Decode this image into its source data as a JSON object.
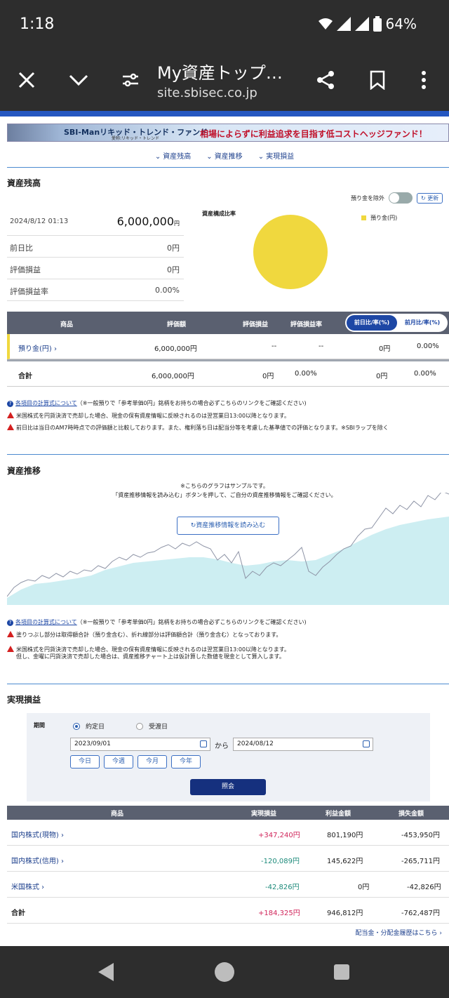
{
  "status": {
    "time": "1:18",
    "battery": "64%"
  },
  "browser": {
    "title": "My資産トップ…",
    "url": "site.sbisec.co.jp"
  },
  "banner": {
    "fund_name": "SBI-Manリキッド・トレンド・ファンド",
    "fund_nickname": "愛称:リキッド・トレンド",
    "tagline": "相場によらずに利益追求を目指す低コストヘッジファンド！"
  },
  "anchors": [
    "資産残高",
    "資産推移",
    "実現損益"
  ],
  "balance": {
    "title": "資産残高",
    "exclude_deposit_label": "預り金を除外",
    "update_label": "更新",
    "datetime": "2024/8/12 01:13",
    "total": "6,000,000",
    "total_unit": "円",
    "rows": [
      {
        "label": "前日比",
        "value": "0円"
      },
      {
        "label": "評価損益",
        "value": "0円"
      },
      {
        "label": "評価損益率",
        "value": "0.00%"
      }
    ],
    "pie_title": "資産構成比率",
    "pie_color": "#f0d83e",
    "legend_label": "預り金(円)",
    "table": {
      "headers": [
        "商品",
        "評価額",
        "評価損益",
        "評価損益率"
      ],
      "toggle_on": "前日比/率(%)",
      "toggle_off": "前月比/率(%)",
      "rows": [
        {
          "name": "預り金(円) ›",
          "value": "6,000,000円",
          "pl": "--",
          "pl_rate": "--",
          "day": "0円",
          "day_rate": "0.00%"
        }
      ],
      "total": {
        "name": "合計",
        "value": "6,000,000円",
        "pl": "0円",
        "pl_rate": "0.00%",
        "day": "0円",
        "day_rate": "0.00%"
      }
    },
    "notes": {
      "calc_link": "各項目の計算式について",
      "calc_rest": "（※一般預りで「参考単価0円」銘柄をお持ちの場合必ずこちらのリンクをご確認ください)",
      "warn1": "米国株式を円貨決済で売却した場合、現金の保有資産情報に反映されるのは翌営業日13:00以降となります。",
      "warn2": "前日比は当日のAM7時時点での評価額と比較しております。また、権利落ち日は配当分等を考慮した基準値での評価となります。※SBIラップを除く"
    }
  },
  "trend": {
    "title": "資産推移",
    "sample_line1": "※こちらのグラフはサンプルです。",
    "sample_line2": "「資産推移情報を読み込む」ボタンを押して、ご自分の資産推移情報をご確認ください。",
    "load_button": "資産推移情報を読み込む",
    "notes": {
      "calc_link": "各項目の計算式について",
      "calc_rest": "（※一般預りで「参考単価0円」銘柄をお持ちの場合必ずこちらのリンクをご確認ください)",
      "warn1": "塗りつぶし部分は取得額合計（預り金含む）、折れ線部分は評価額合計（預り金含む）となっております。",
      "warn2a": "米国株式を円貨決済で売却した場合、現金の保有資産情報に反映されるのは翌営業日13:00以降となります。",
      "warn2b": "但し、金曜に円貨決済で売却した場合は、資産推移チャート上は仮計算した数値を現金として算入します。"
    }
  },
  "realized": {
    "title": "実現損益",
    "period_label": "期間",
    "radio_trade": "約定日",
    "radio_settle": "受渡日",
    "date_from": "2023/09/01",
    "date_to": "2024/08/12",
    "kara": "から",
    "quick": [
      "今日",
      "今週",
      "今月",
      "今年"
    ],
    "query_button": "照会",
    "headers": [
      "商品",
      "実現損益",
      "利益金額",
      "損失金額"
    ],
    "rows": [
      {
        "name": "国内株式(現物) ›",
        "pl": "+347,240円",
        "gain": "801,190円",
        "loss": "-453,950円"
      },
      {
        "name": "国内株式(信用) ›",
        "pl": "-120,089円",
        "gain": "145,622円",
        "loss": "-265,711円"
      },
      {
        "name": "米国株式 ›",
        "pl": "-42,826円",
        "gain": "0円",
        "loss": "-42,826円"
      }
    ],
    "total": {
      "name": "合計",
      "pl": "+184,325円",
      "gain": "946,812円",
      "loss": "-762,487円"
    },
    "dividend_link": "配当金・分配金履歴はこちら ›"
  }
}
